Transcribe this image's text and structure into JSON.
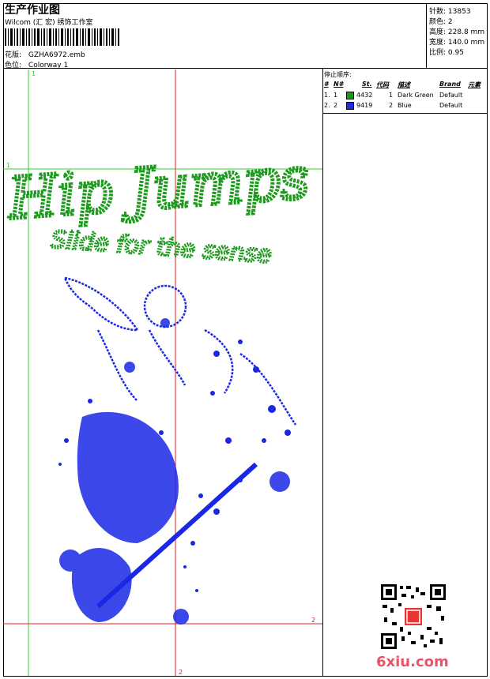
{
  "header": {
    "title": "生产作业图",
    "subtitle": "Wilcom (汇 宏) 绣饰工作室",
    "design_label": "花版:",
    "design_value": "GZHA6972.emb",
    "colorway_label": "色位:",
    "colorway_value": "Colorway 1"
  },
  "stats": [
    {
      "label": "针数:",
      "value": "13853"
    },
    {
      "label": "颜色:",
      "value": "2"
    },
    {
      "label": "高度:",
      "value": "228.8 mm"
    },
    {
      "label": "宽度:",
      "value": "140.0 mm"
    },
    {
      "label": "比例:",
      "value": "0.95"
    }
  ],
  "stop_sequence": {
    "title": "停止顺序:",
    "headers": [
      "#",
      "N#",
      "St.",
      "代码",
      "描述",
      "Brand",
      "元素"
    ],
    "rows": [
      {
        "index": "1.",
        "n": "1",
        "code": "4432",
        "st": "1",
        "desc": "Dark Green",
        "brand": "Default",
        "color": "#1a9a1a"
      },
      {
        "index": "2.",
        "n": "2",
        "code": "9419",
        "st": "2",
        "desc": "Blue",
        "brand": "Default",
        "color": "#1a2ee0"
      }
    ]
  },
  "design": {
    "line1": "Hip Jumps",
    "line2": "Slide for the sense",
    "thread1": "#1e9a1e",
    "thread2": "#1a28e6",
    "marker_labels": [
      "1",
      "1",
      "2",
      "2"
    ]
  },
  "watermark": "6xiu.com"
}
